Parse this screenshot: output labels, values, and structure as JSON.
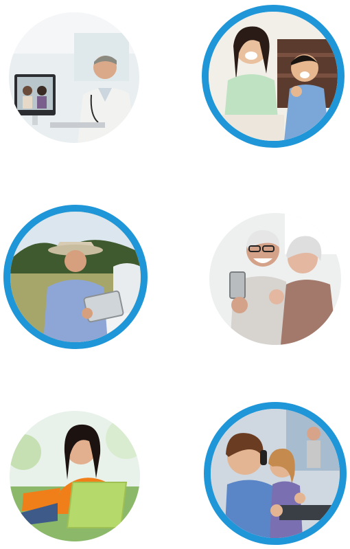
{
  "theme": {
    "ring_color": "#1f96d8",
    "background": "#ffffff"
  },
  "photos": [
    {
      "id": "doctor-video-call",
      "ring": false
    },
    {
      "id": "mother-son-laughing",
      "ring": true
    },
    {
      "id": "farmer-tablet",
      "ring": true
    },
    {
      "id": "seniors-video-selfie",
      "ring": false
    },
    {
      "id": "woman-laptop-outdoors",
      "ring": false
    },
    {
      "id": "children-classroom-laptops",
      "ring": true
    }
  ]
}
